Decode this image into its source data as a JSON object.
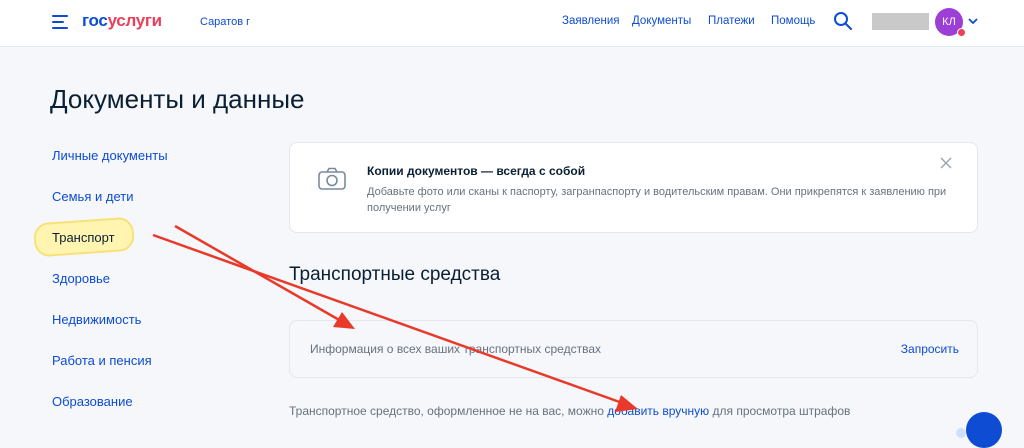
{
  "header": {
    "logo": {
      "part1": "гос",
      "part2": "услуги"
    },
    "city": "Саратов г",
    "nav": [
      "Заявления",
      "Документы",
      "Платежи",
      "Помощь"
    ],
    "avatar_initials": "КЛ",
    "icons": [
      "menu-icon",
      "search-icon",
      "chevron-down-icon"
    ]
  },
  "page": {
    "title": "Документы и данные"
  },
  "sidebar": {
    "items": [
      {
        "label": "Личные документы"
      },
      {
        "label": "Семья и дети"
      },
      {
        "label": "Транспорт"
      },
      {
        "label": "Здоровье"
      },
      {
        "label": "Недвижимость"
      },
      {
        "label": "Работа и пенсия"
      },
      {
        "label": "Образование"
      }
    ]
  },
  "banner": {
    "icon": "camera-icon",
    "title": "Копии документов — всегда с собой",
    "text": "Добавьте фото или сканы к паспорту, загранпаспорту и водительским правам. Они прикрепятся к заявлению при получении услуг"
  },
  "vehicles": {
    "title": "Транспортные средства",
    "info_text": "Информация о всех ваших транспортных средствах",
    "request_label": "Запросить",
    "note_before": "Транспортное средство, оформленное не на вас, можно ",
    "note_link": "добавить вручную",
    "note_after": " для просмотра штрафов"
  },
  "colors": {
    "accent": "#0d4cd3",
    "logo_red": "#ee3f58",
    "annotation_red": "#e8392b",
    "highlight": "#fff5b0",
    "avatar": "#9b3fd6"
  }
}
